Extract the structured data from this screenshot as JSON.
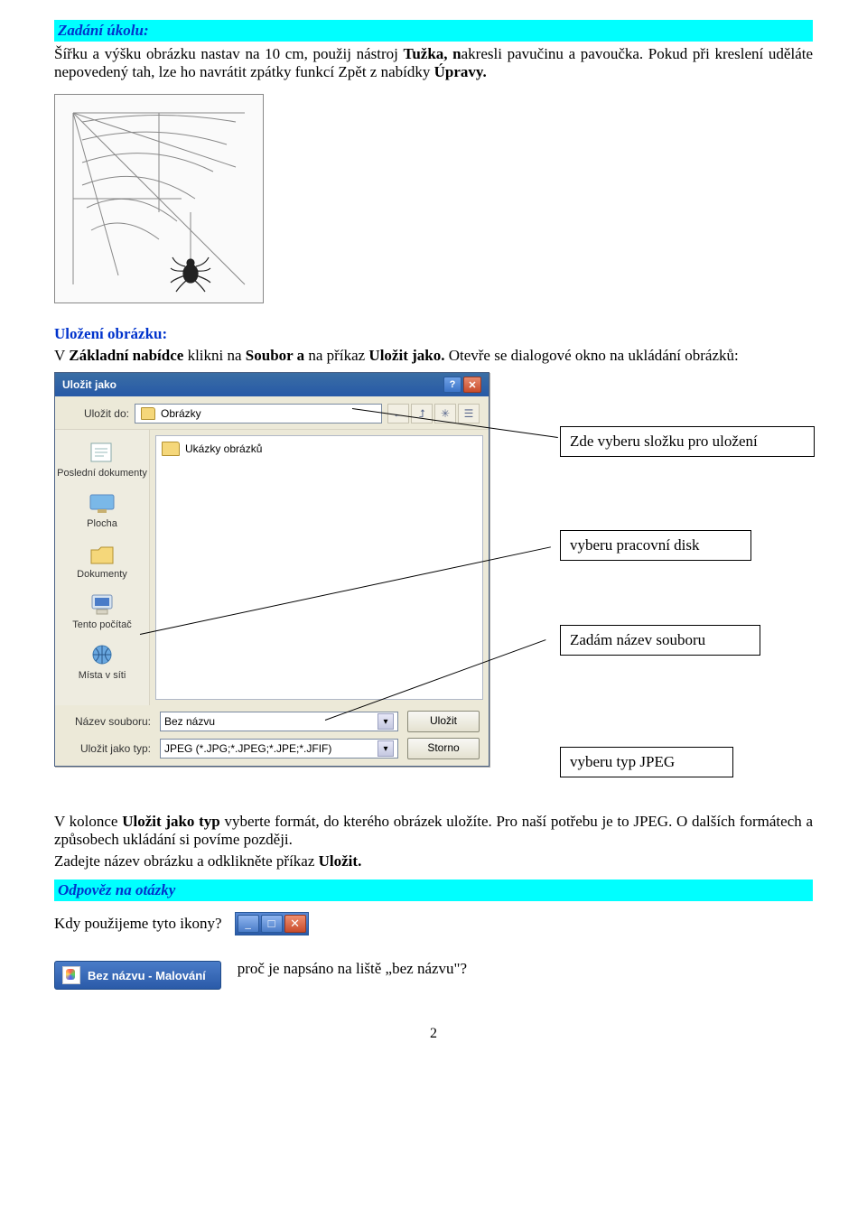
{
  "task": {
    "heading": "Zadání úkolu:",
    "body_1": "Šířku a výšku obrázku nastav na 10 cm, použij  nástroj ",
    "body_tuzka": "Tužka, n",
    "body_2": "akresli pavučinu a pavoučka. Pokud při kreslení uděláte nepovedený tah, lze ho navrátit zpátky funkcí Zpět z nabídky ",
    "body_upravy": "Úpravy."
  },
  "save_section": {
    "heading": "Uložení obrázku:",
    "line1_a": "V ",
    "line1_b": "Základní nabídce",
    "line1_c": " klikni na ",
    "line1_d": "Soubor a",
    "line1_e": " na příkaz ",
    "line1_f": "Uložit jako.",
    "line1_g": " Otevře se dialogové okno na ukládání obrázků:"
  },
  "callouts": {
    "c1": "Zde vyberu složku pro uložení",
    "c2": "vyberu pracovní disk",
    "c3": "Zadám název souboru",
    "c4": "vyberu typ JPEG"
  },
  "dialog": {
    "title": "Uložit jako",
    "lookin_label": "Uložit do:",
    "lookin_value": "Obrázky",
    "folder_item": "Ukázky obrázků",
    "places": {
      "recent": "Poslední dokumenty",
      "desktop": "Plocha",
      "mydocs": "Dokumenty",
      "mycomp": "Tento počítač",
      "network": "Místa v síti"
    },
    "name_label": "Název souboru:",
    "name_value": "Bez názvu",
    "type_label": "Uložit jako typ:",
    "type_value": "JPEG (*.JPG;*.JPEG;*.JPE;*.JFIF)",
    "btn_save": "Uložit",
    "btn_cancel": "Storno"
  },
  "after_dialog": {
    "p1_a": "V kolonce ",
    "p1_b": "Uložit jako typ",
    "p1_c": " vyberte formát, do kterého obrázek uložíte. Pro naší potřebu je to JPEG. O dalších formátech a způsobech ukládání si povíme později.",
    "p2_a": "Zadejte název obrázku a odklikněte příkaz ",
    "p2_b": "Uložit."
  },
  "questions": {
    "heading": "Odpověz na otázky",
    "q1": "Kdy použijeme tyto ikony?",
    "taskbar_label": "Bez názvu - Malování",
    "q2": "proč je napsáno na liště „bez názvu\"?"
  },
  "page_number": "2"
}
